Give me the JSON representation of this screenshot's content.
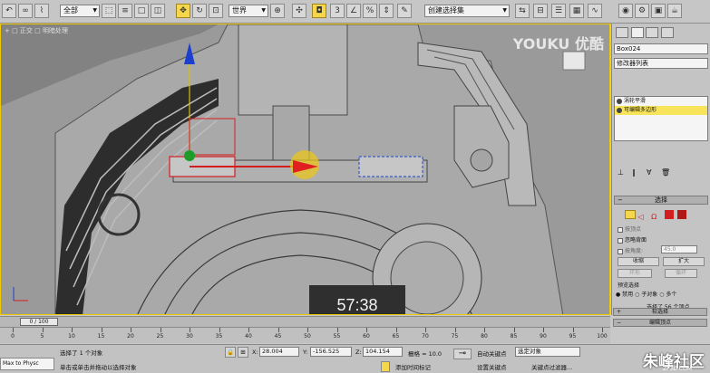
{
  "toolbar": {
    "selection_filter": "全部",
    "ref_coord": "世界",
    "named_selection": "创建选择集"
  },
  "viewport": {
    "label": "+ □ 正交 □ 明暗处理",
    "watermark": "YOUKU 优酷",
    "timer": "57:38"
  },
  "command_panel": {
    "object_name": "Box024",
    "modifier_list": "修改器列表",
    "stack": [
      {
        "label": "涡轮平滑"
      },
      {
        "label": "可编辑多边形",
        "selected": true
      }
    ],
    "selection_rollout": "选择",
    "by_vertex": "按顶点",
    "ignore_backface": "忽略背面",
    "by_angle": "按角度:",
    "angle_value": "45.0",
    "shrink": "收缩",
    "grow": "扩大",
    "ring": "环形",
    "loop": "循环",
    "preview_selection": "预览选择",
    "preview_options": [
      "禁用",
      "子对象",
      "多个"
    ],
    "selected_info": "选择了 56 个顶点",
    "soft_selection": "软选择",
    "edit_vertices": "编辑顶点"
  },
  "timeline": {
    "slider_label": "0 / 100",
    "ticks": [
      "0",
      "5",
      "10",
      "15",
      "20",
      "25",
      "30",
      "35",
      "40",
      "45",
      "50",
      "55",
      "60",
      "65",
      "70",
      "75",
      "80",
      "85",
      "90",
      "95",
      "100"
    ]
  },
  "status_bar": {
    "selection_info": "选择了 1 个对象",
    "prompt": "单击或单击并拖动以选择对象",
    "x_label": "X:",
    "x_value": "28.004",
    "y_label": "Y:",
    "y_value": "-156.525",
    "z_label": "Z:",
    "z_value": "104.154",
    "grid": "栅格 = 10.0",
    "add_time_tag": "添加时间标记",
    "auto_key": "自动关键点",
    "set_key": "设置关键点",
    "selected_object": "选定对象",
    "key_filters": "关键点过滤器...",
    "maxscript": "Max to Physc"
  },
  "brand": {
    "logo_text": "朱峰社区",
    "logo_sub": "ZF3D.COM"
  }
}
